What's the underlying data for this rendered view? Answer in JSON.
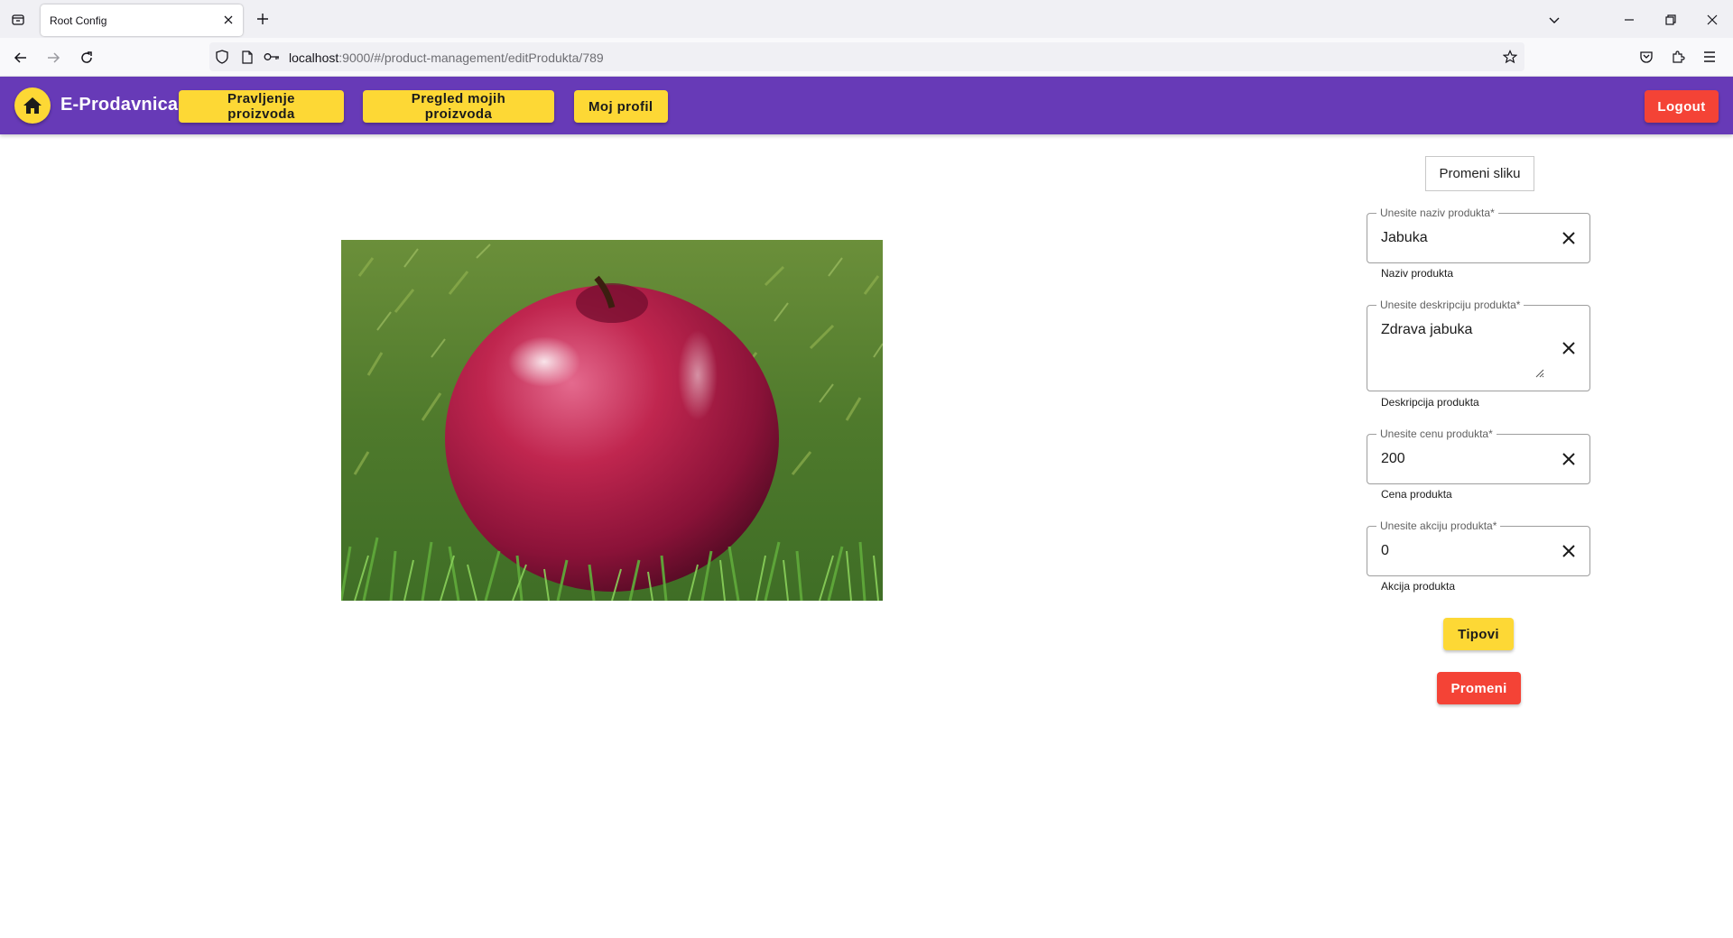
{
  "browser": {
    "tab_title": "Root Config",
    "url_host": "localhost",
    "url_rest": ":9000/#/product-management/editProdukta/789"
  },
  "header": {
    "brand": "E-Prodavnica",
    "nav": {
      "create_label": "Pravljenje proizvoda",
      "my_products_label": "Pregled mojih proizvoda",
      "profile_label": "Moj profil"
    },
    "logout_label": "Logout"
  },
  "form": {
    "change_image_label": "Promeni sliku",
    "name": {
      "label": "Unesite naziv produkta*",
      "value": "Jabuka",
      "hint": "Naziv produkta"
    },
    "description": {
      "label": "Unesite deskripciju produkta*",
      "value": "Zdrava jabuka",
      "hint": "Deskripcija produkta"
    },
    "price": {
      "label": "Unesite cenu produkta*",
      "value": "200",
      "hint": "Cena produkta"
    },
    "discount": {
      "label": "Unesite akciju produkta*",
      "value": "0",
      "hint": "Akcija produkta"
    },
    "types_label": "Tipovi",
    "submit_label": "Promeni"
  },
  "colors": {
    "header_bg": "#673ab7",
    "accent_yellow": "#fdd835",
    "accent_red": "#f44336"
  },
  "icons": [
    "tab-list-icon",
    "close-icon",
    "plus-icon",
    "chevron-down-icon",
    "minimize-icon",
    "restore-icon",
    "back-icon",
    "forward-icon",
    "reload-icon",
    "shield-icon",
    "page-icon",
    "key-icon",
    "star-icon",
    "pocket-icon",
    "extensions-icon",
    "menu-icon",
    "home-icon",
    "clear-icon"
  ]
}
